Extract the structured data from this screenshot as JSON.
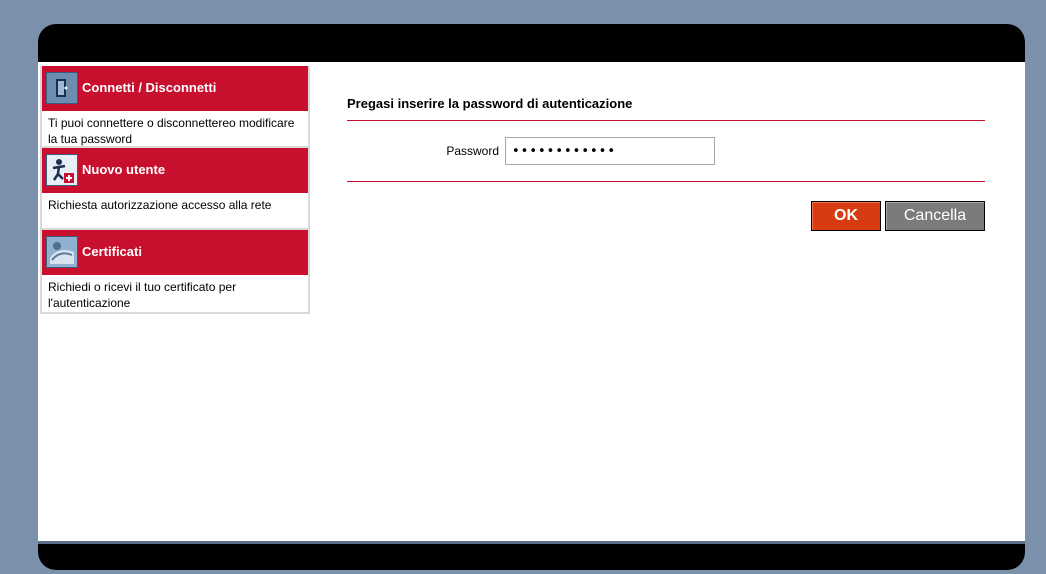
{
  "sidebar": {
    "items": [
      {
        "title": "Connetti / Disconnetti",
        "description": "Ti puoi connettere o disconnettereo modificare la tua password",
        "icon": "connect-icon"
      },
      {
        "title": "Nuovo utente",
        "description": "Richiesta autorizzazione accesso alla rete",
        "icon": "new-user-icon"
      },
      {
        "title": "Certificati",
        "description": "Richiedi o ricevi il tuo certificato per l'autenticazione",
        "icon": "certificate-icon"
      }
    ]
  },
  "main": {
    "heading": "Pregasi inserire la password di autenticazione",
    "password_label": "Password",
    "password_value": "123456789012",
    "ok_label": "OK",
    "cancel_label": "Cancella"
  },
  "colors": {
    "brand_red": "#c8102e",
    "ok_orange": "#d63b12",
    "cancel_gray": "#7b7b7b",
    "background": "#7a90ab",
    "frame_black": "#000000"
  }
}
